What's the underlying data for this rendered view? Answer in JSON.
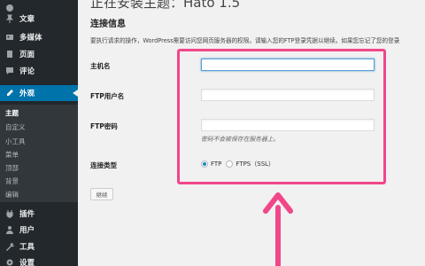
{
  "sidebar": {
    "items": [
      {
        "label": "",
        "icon": "dashboard-icon"
      },
      {
        "label": "文章",
        "icon": "pin-icon"
      },
      {
        "label": "多媒体",
        "icon": "media-icon"
      },
      {
        "label": "页面",
        "icon": "page-icon"
      },
      {
        "label": "评论",
        "icon": "comment-icon"
      },
      {
        "label": "外观",
        "icon": "appearance-icon",
        "active": true
      },
      {
        "label": "插件",
        "icon": "plugin-icon"
      },
      {
        "label": "用户",
        "icon": "user-icon"
      },
      {
        "label": "工具",
        "icon": "tool-icon"
      },
      {
        "label": "设置",
        "icon": "settings-icon"
      }
    ],
    "submenu": [
      "主题",
      "自定义",
      "小工具",
      "菜单",
      "顶部",
      "背景",
      "编辑"
    ]
  },
  "main": {
    "page_title": "正在安装主题：Hato 1.5",
    "section_heading": "连接信息",
    "intro": "要执行请求的操作，WordPress需要访问您网页服务器的权限。请输入您的FTP登录凭据以继续。如果您忘记了您的登录",
    "fields": {
      "hostname_label": "主机名",
      "username_label": "FTP用户名",
      "password_label": "FTP密码",
      "password_hint": "密码不会被保存在服务器上。",
      "conn_type_label": "连接类型"
    },
    "conn_types": {
      "ftp": "FTP",
      "ftps": "FTPS（SSL）",
      "selected": "FTP"
    },
    "submit_label": "继续"
  },
  "colors": {
    "sidebar_bg": "#23282d",
    "active_bg": "#0073aa",
    "annotation": "#f0478a"
  }
}
